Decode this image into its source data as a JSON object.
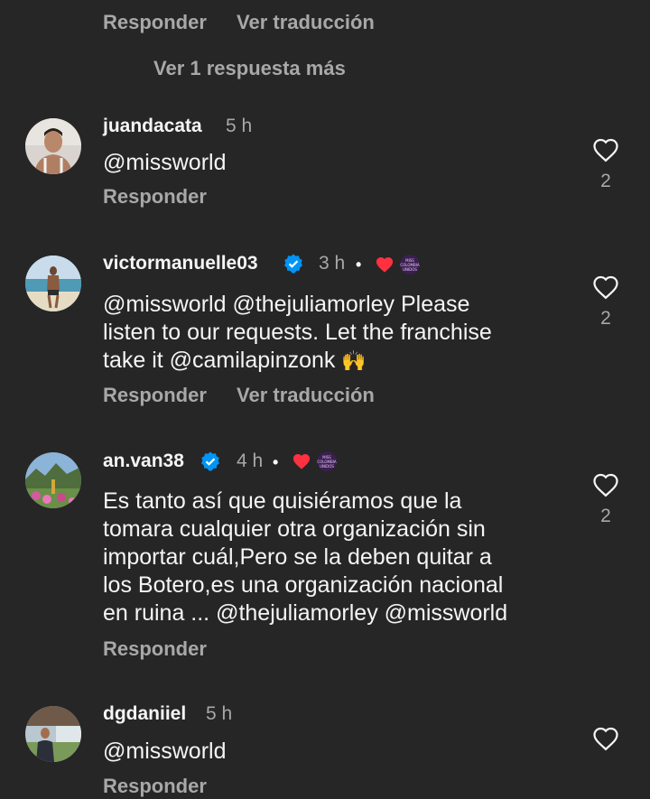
{
  "top": {
    "reply_label": "Responder",
    "translate_label": "Ver traducción",
    "more_replies": "Ver 1 respuesta más"
  },
  "comments": [
    {
      "username": "juandacata",
      "time": "5 h",
      "text": "@missworld",
      "reply_label": "Responder",
      "likes": "2"
    },
    {
      "username": "victormanuelle03",
      "time": "3 h",
      "dot": "•",
      "text_line1": "@missworld @thejuliamorley Please",
      "text_line2": "listen to our requests. Let the franchise",
      "text_line3": "take it @camilapinzonk",
      "emoji": "🙌",
      "reply_label": "Responder",
      "translate_label": "Ver traducción",
      "likes": "2",
      "badge_text": "MISS COLOMBIA UNIDOS"
    },
    {
      "username": "an.van38",
      "time": "4 h",
      "dot": "•",
      "text_line1": "Es tanto así que quisiéramos que la",
      "text_line2": "tomara cualquier otra organización sin",
      "text_line3": "importar cuál,Pero se la deben quitar a",
      "text_line4": "los Botero,es una organización nacional",
      "text_line5": "en ruina ... @thejuliamorley @missworld",
      "reply_label": "Responder",
      "likes": "2",
      "badge_text": "MISS COLOMBIA UNIDOS"
    },
    {
      "username": "dgdaniiel",
      "time": "5 h",
      "text": "@missworld",
      "reply_label": "Responder"
    }
  ],
  "colors": {
    "background": "#262626",
    "text": "#f5f5f5",
    "muted": "#a8a8a8",
    "verified": "#0095f6",
    "heart_red": "#ff3040"
  }
}
